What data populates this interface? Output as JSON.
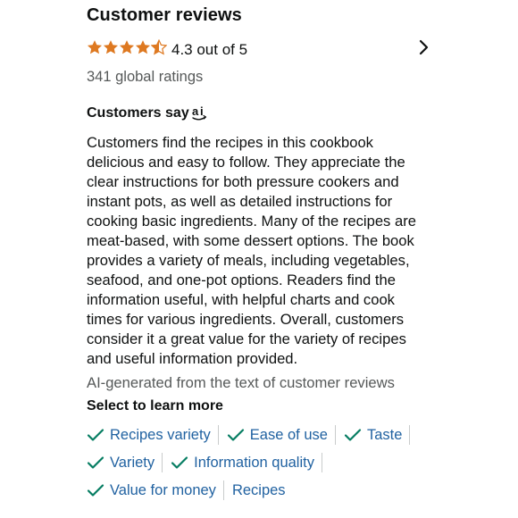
{
  "header": {
    "title": "Customer reviews"
  },
  "rating": {
    "value": 4.3,
    "text": "4.3 out of 5",
    "global_ratings": "341 global ratings",
    "star_color": "#de7921"
  },
  "customers_say": {
    "heading": "Customers say",
    "icon": "ai-icon",
    "summary_lines": [
      "Customers find the recipes in this cookbook",
      "delicious and easy to follow. They appreciate the",
      "clear instructions for both pressure cookers and",
      "instant pots, as well as detailed instructions for",
      "cooking basic ingredients. Many of the recipes are",
      "meat-based, with some dessert options. The book",
      "provides a variety of meals, including vegetables,",
      "seafood, and one-pot options. Readers find the",
      "information useful, with helpful charts and cook",
      "times for various ingredients. Overall, customers",
      "consider it a great value for the variety of recipes",
      "and useful information provided."
    ],
    "ai_note": "AI-generated from the text of customer reviews"
  },
  "learn_more": {
    "heading": "Select to learn more",
    "link_color": "#2162a1",
    "check_color": "#067d62",
    "rows": [
      [
        {
          "label": "Recipes variety",
          "checked": true
        },
        {
          "label": "Ease of use",
          "checked": true
        },
        {
          "label": "Taste",
          "checked": true
        }
      ],
      [
        {
          "label": "Variety",
          "checked": true
        },
        {
          "label": "Information quality",
          "checked": true
        }
      ],
      [
        {
          "label": "Value for money",
          "checked": true
        },
        {
          "label": "Recipes",
          "checked": false
        }
      ]
    ]
  }
}
